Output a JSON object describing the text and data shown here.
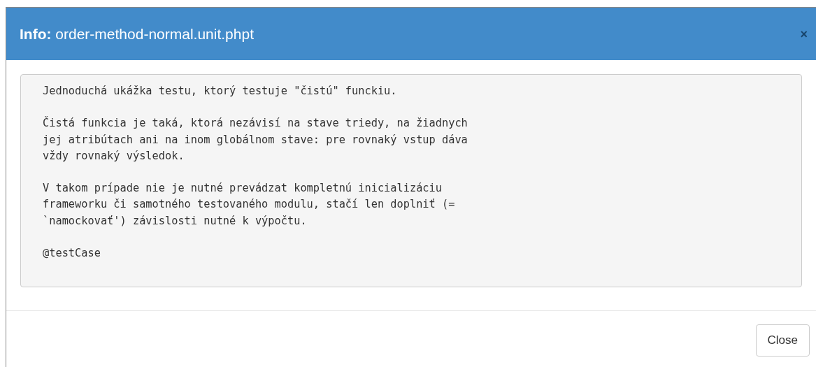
{
  "modal": {
    "title_prefix": "Info:",
    "title": "order-method-normal.unit.phpt",
    "close_icon": "×",
    "description": "Jednoduchá ukážka testu, ktorý testuje \"čistú\" funckiu.\n\nČistá funkcia je taká, ktorá nezávisí na stave triedy, na žiadnych\njej atribútach ani na inom globálnom stave: pre rovnaký vstup dáva\nvždy rovnaký výsledok.\n\nV takom prípade nie je nutné prevádzat kompletnú inicializáciu\nframeworku či samotného testovaného modulu, stačí len doplniť (=\n`namockovať') závislosti nutné k výpočtu.\n\n@testCase",
    "buttons": [
      "Close"
    ]
  }
}
